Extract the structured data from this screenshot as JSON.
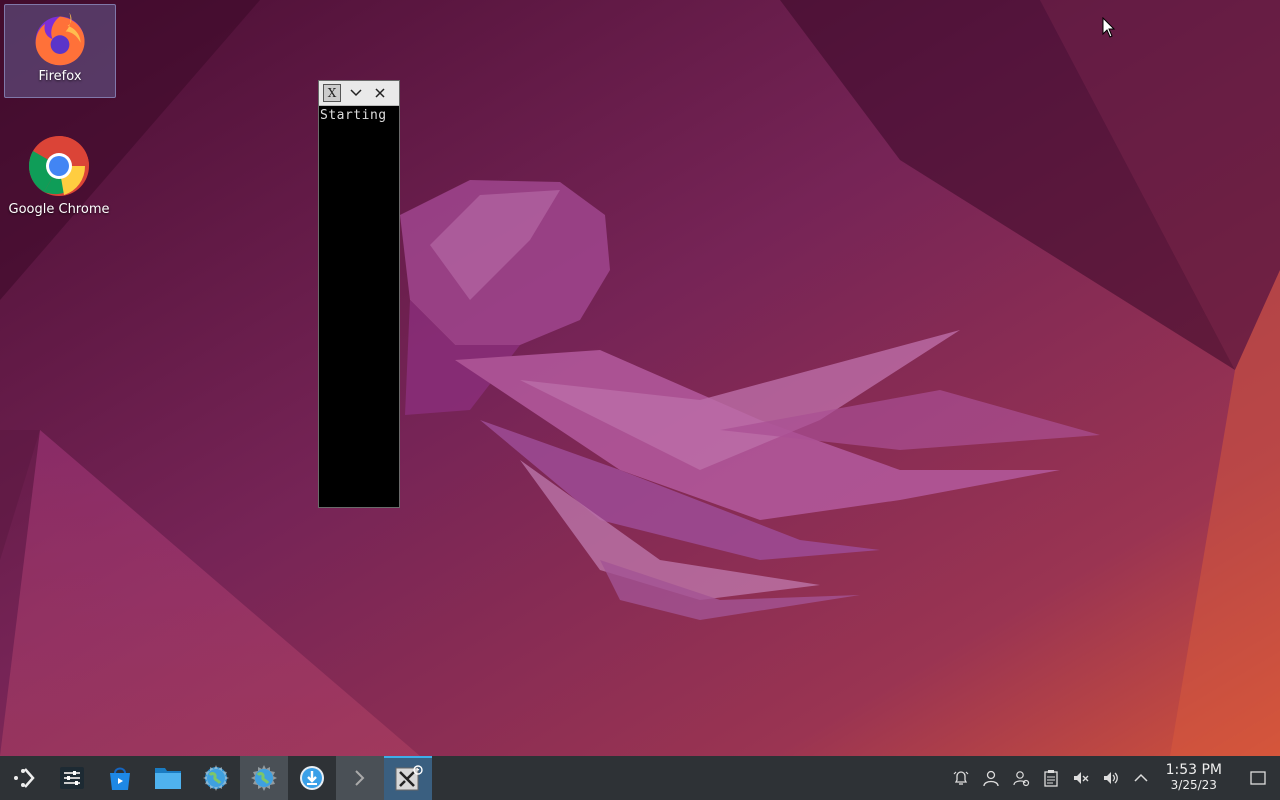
{
  "desktop": {
    "icons": [
      {
        "label": "Firefox",
        "icon": "firefox-icon"
      },
      {
        "label": "Google Chrome",
        "icon": "chrome-icon"
      }
    ]
  },
  "xwindow": {
    "title_icon": "X",
    "content": "Starting"
  },
  "taskbar": {
    "items": [
      {
        "icon": "app-launcher-icon"
      },
      {
        "icon": "system-settings-icon"
      },
      {
        "icon": "discover-store-icon"
      },
      {
        "icon": "file-manager-icon"
      },
      {
        "icon": "web-browser-icon"
      },
      {
        "icon": "web-browser-icon"
      },
      {
        "icon": "download-icon"
      },
      {
        "icon": "terminal-icon"
      },
      {
        "icon": "x-app-icon"
      }
    ],
    "tray": [
      {
        "icon": "notifications-icon"
      },
      {
        "icon": "user-icon"
      },
      {
        "icon": "user-switch-icon"
      },
      {
        "icon": "clipboard-icon"
      },
      {
        "icon": "muted-speaker-icon"
      },
      {
        "icon": "volume-icon"
      },
      {
        "icon": "expand-tray-icon"
      }
    ],
    "clock": {
      "time": "1:53 PM",
      "date": "3/25/23"
    }
  },
  "colors": {
    "wallpaper_base": "#6a1f4a",
    "wallpaper_accent": "#e0533a",
    "taskbar": "#2e3236",
    "accent": "#3daee9"
  }
}
